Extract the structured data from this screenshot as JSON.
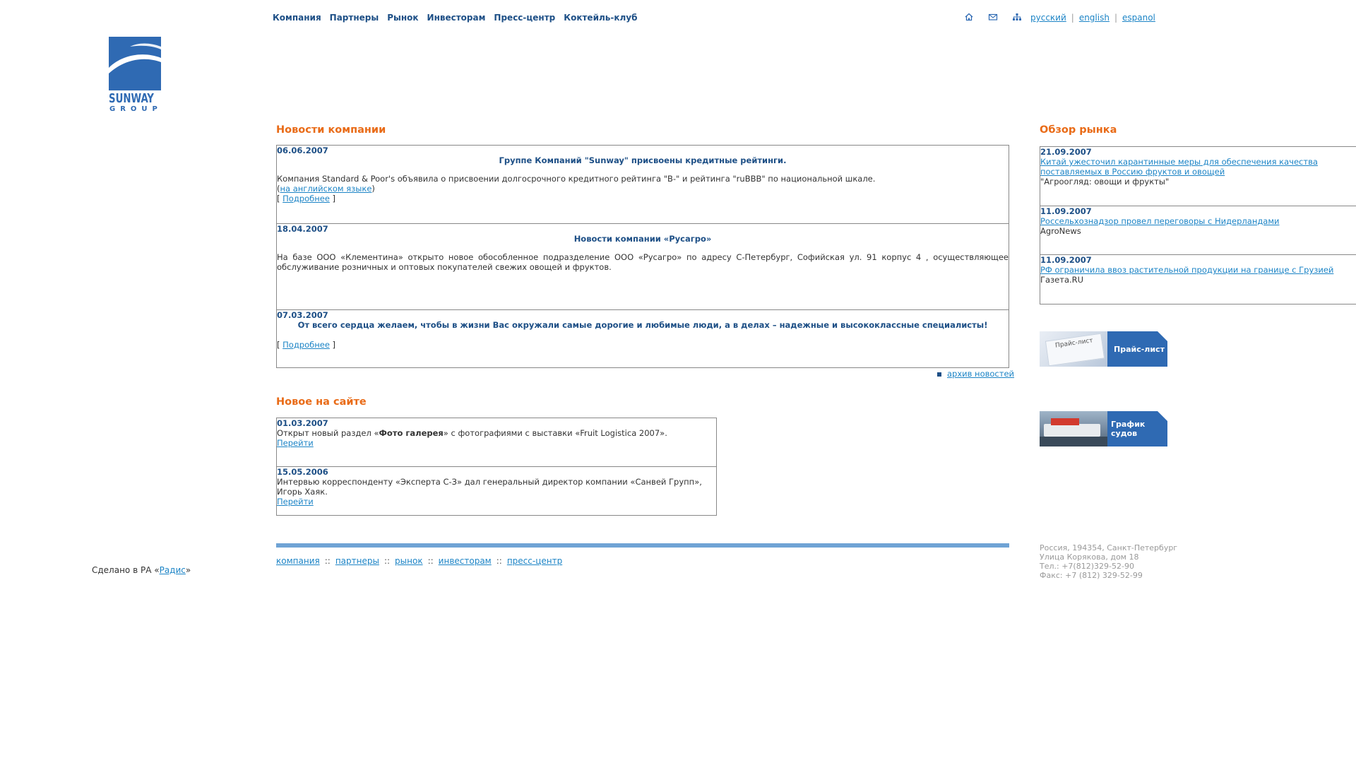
{
  "nav": {
    "items": [
      "Компания",
      "Партнеры",
      "Рынок",
      "Инвесторам",
      "Пресс-центр",
      "Коктейль-клуб"
    ]
  },
  "utility": {
    "icons": [
      "home-icon",
      "mail-icon",
      "sitemap-icon"
    ],
    "languages": [
      "русский",
      "english",
      "espanol"
    ],
    "separator": "|"
  },
  "logo": {
    "word1": "SUNWAY",
    "word2": "GROUP"
  },
  "company_news": {
    "title": "Новости компании",
    "items": [
      {
        "date": "06.06.2007",
        "headline": "Группе Компаний \"Sunway\" присвоены кредитные рейтинги.",
        "body": "Компания Standard & Poor's объявила о присвоении долгосрочного кредитного рейтинга \"B-\" и рейтинга \"ruBBB\" по национальной шкале.",
        "link_prefix": "(",
        "link_text": "на английском языке",
        "link_suffix": ")",
        "more_open": "[ ",
        "more_text": "Подробнее",
        "more_close": " ]"
      },
      {
        "date": "18.04.2007",
        "headline": "Новости компании «Русагро»",
        "body": "На базе ООО «Клементина» открыто новое обособленное подразделение ООО «Русагро» по адресу С-Петербург, Софийская ул. 91 корпус 4 , осуществляющее обслуживание розничных и оптовых покупателей свежих овощей и фруктов."
      },
      {
        "date": "07.03.2007",
        "headline": "От всего сердца желаем, чтобы в жизни Вас окружали самые дорогие и любимые люди, а в делах – надежные и высококлассные специалисты!",
        "more_open": "[ ",
        "more_text": "Подробнее",
        "more_close": " ]"
      }
    ],
    "archive_link": "архив новостей"
  },
  "whats_new": {
    "title": "Новое на сайте",
    "items": [
      {
        "date": "01.03.2007",
        "text_before": "Открыт новый раздел «",
        "text_bold": "Фото галерея",
        "text_after": "» с фотографиями с выставки «Fruit Logistica 2007».",
        "link": "Перейти"
      },
      {
        "date": "15.05.2006",
        "text": "Интервью корреспонденту «Эксперта С-З» дал генеральный директор компании «Санвей Групп», Игорь Хаяк.",
        "link": "Перейти"
      }
    ]
  },
  "market_review": {
    "title": "Обзор рынка",
    "items": [
      {
        "date": "21.09.2007",
        "link": "Китай ужесточил карантинные меры для обеспечения качества поставляемых в Россию фруктов и овощей",
        "source": "\"Агроогляд: овощи и фрукты\""
      },
      {
        "date": "11.09.2007",
        "link": "Россельхознадзор провел переговоры с Нидерландами",
        "source": "AgroNews"
      },
      {
        "date": "11.09.2007",
        "link": "РФ ограничила ввоз растительной продукции на границе с Грузией",
        "source": "Газета.RU"
      }
    ]
  },
  "promos": [
    {
      "label": "Прайс-лист",
      "image_text": "Прайс-лист"
    },
    {
      "label": "График судов"
    }
  ],
  "footer": {
    "links": [
      "компания",
      "партнеры",
      "рынок",
      "инвесторам",
      "пресс-центр"
    ],
    "separator": "::",
    "made_prefix": "Сделано в РА «",
    "made_link": "Радис",
    "made_suffix": "»",
    "address": [
      "Россия, 194354, Санкт-Петербург",
      "Улица Корякова, дом 18",
      "Тел.:  +7(812)329-52-90",
      "Факс: +7 (812) 329-52-99"
    ]
  }
}
